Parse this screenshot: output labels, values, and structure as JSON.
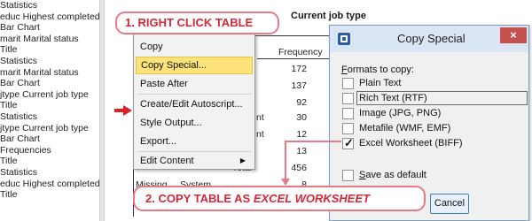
{
  "outline": [
    "Statistics",
    "educ Highest completed",
    "Bar Chart",
    "marit Marital status",
    "Title",
    "Statistics",
    "marit Marital status",
    "Bar Chart",
    "jtype Current job type",
    "Title",
    "Statistics",
    "jtype Current job type",
    "Bar Chart",
    "Frequencies",
    "Title",
    "Statistics",
    "educ Highest completed e",
    "Title"
  ],
  "output_table": {
    "title": "Current job type",
    "frequency_header": "Frequency",
    "frequencies": [
      "172",
      "137",
      "92",
      "30",
      "12",
      "13",
      "456",
      "8"
    ],
    "row_fragments": [
      "nt",
      "nt",
      "Total"
    ],
    "missing_label": "Missing",
    "system_label": "System",
    "total_fragment": "To"
  },
  "context_menu": {
    "items": [
      "Copy",
      "Copy Special...",
      "Paste After",
      "Create/Edit Autoscript...",
      "Style Output...",
      "Export...",
      "Edit Content"
    ],
    "highlighted": "Copy Special..."
  },
  "callouts": {
    "step1": "1. RIGHT CLICK TABLE",
    "step2_prefix": "2. COPY TABLE AS ",
    "step2_emphasis": "EXCEL WORKSHEET"
  },
  "dialog": {
    "title": "Copy Special",
    "close_glyph": "×",
    "formats_label_hotkey": "F",
    "formats_label_rest": "ormats to copy:",
    "formats": [
      {
        "label": "Plain Text",
        "checked": false
      },
      {
        "label": "Rich Text (RTF)",
        "checked": false
      },
      {
        "label": "Image (JPG, PNG)",
        "checked": false
      },
      {
        "label": "Metafile (WMF, EMF)",
        "checked": false
      },
      {
        "label": "Excel Worksheet (BIFF)",
        "checked": true
      }
    ],
    "save_default_hotkey": "S",
    "save_default_rest": "ave as default",
    "cancel_label": "Cancel"
  },
  "colors": {
    "callout_border": "#e87a86",
    "callout_text": "#d2283a",
    "menu_highlight": "#fbe27a",
    "dialog_close": "#c75050"
  },
  "icons": {
    "marker": "red-right-arrow-icon",
    "submenu": "submenu-arrow-icon",
    "dialog_app": "spss-app-icon",
    "checkmark": "checkmark-icon"
  }
}
